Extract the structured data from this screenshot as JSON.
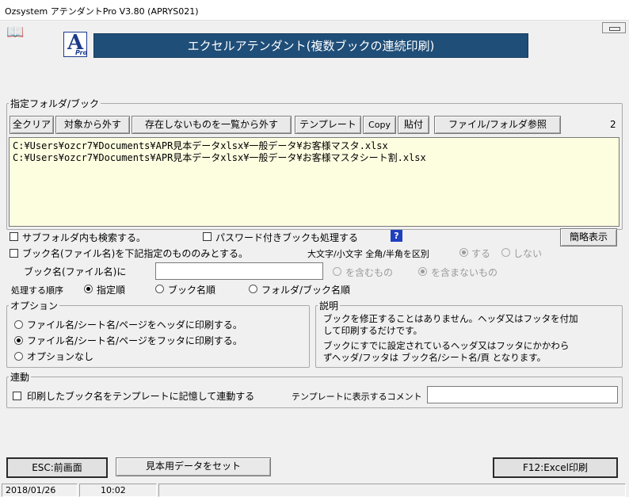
{
  "window": {
    "title": "Ozsystem アテンダントPro V3.80 (APRYS021)"
  },
  "header": {
    "banner": "エクセルアテンダント(複数ブックの連続印刷)",
    "logo_letter": "A",
    "logo_sub": "Pro",
    "banner_color": "#1f4e79"
  },
  "folder_group": {
    "legend": "指定フォルダ/ブック",
    "buttons": [
      "全クリア",
      "対象から外す",
      "存在しないものを一覧から外す",
      "テンプレート",
      "Copy",
      "貼付",
      "ファイル/フォルダ参照"
    ],
    "count": "2",
    "files": [
      "C:¥Users¥ozcr7¥Documents¥APR見本データxlsx¥一般データ¥お客様マスタ.xlsx",
      "C:¥Users¥ozcr7¥Documents¥APR見本データxlsx¥一般データ¥お客様マスタシート割.xlsx"
    ],
    "list_bg": "#fdfde0"
  },
  "options_top": {
    "subfolder": "サブフォルダ内も検索する。",
    "password": "パスワード付きブックも処理する",
    "help_icon": "?",
    "simple_view": "簡略表示",
    "bookname_only": "ブック名(ファイル名)を下記指定のもののみとする。",
    "case_label": "大文字/小文字 全角/半角を区別",
    "case_yes": "する",
    "case_no": "しない",
    "bookname_label": "ブック名(ファイル名)に",
    "bookname_value": "",
    "include": "を含むもの",
    "exclude": "を含まないもの",
    "order_label": "処理する順序",
    "order_options": [
      "指定順",
      "ブック名順",
      "フォルダ/ブック名順"
    ],
    "order_selected": 0
  },
  "option_group": {
    "legend": "オプション",
    "items": [
      "ファイル名/シート名/ページをヘッダに印刷する。",
      "ファイル名/シート名/ページをフッタに印刷する。",
      "オプションなし"
    ],
    "selected": 1
  },
  "desc_group": {
    "legend": "説明",
    "line1": "ブックを修正することはありません。ヘッダ又はフッタを付加",
    "line2": "して印刷するだけです。",
    "line3": "ブックにすでに設定されているヘッダ又はフッタにかかわら",
    "line4": "ずヘッダ/フッタは ブック名/シート名/頁 となります。"
  },
  "link_group": {
    "legend": "連動",
    "checkbox": "印刷したブック名をテンプレートに記憶して連動する",
    "comment_label": "テンプレートに表示するコメント",
    "comment_value": ""
  },
  "footer": {
    "esc": "ESC:前画面",
    "sample": "見本用データをセット",
    "print": "F12:Excel印刷"
  },
  "status": {
    "date": "2018/01/26",
    "time": "10:02"
  }
}
